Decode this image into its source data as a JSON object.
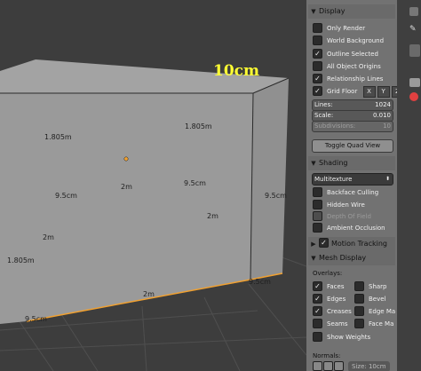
{
  "viewport": {
    "overlay_text": "10cm",
    "dimensions": [
      "1.805m",
      "1.805m",
      "2m",
      "9.5cm",
      "9.5cm",
      "9.5cm",
      "2m",
      "2m",
      "1.805m",
      "2m",
      "9.5cm",
      "9.5cm"
    ]
  },
  "panel": {
    "display": {
      "title": "Display",
      "only_render": "Only Render",
      "world_background": "World Background",
      "outline_selected": "Outline Selected",
      "all_object_origins": "All Object Origins",
      "relationship_lines": "Relationship Lines",
      "grid_floor": "Grid Floor",
      "axes": [
        "X",
        "Y",
        "Z"
      ],
      "lines_label": "Lines:",
      "lines_value": "1024",
      "scale_label": "Scale:",
      "scale_value": "0.010",
      "subdivisions_label": "Subdivisions:",
      "subdivisions_value": "10",
      "toggle_quad_view": "Toggle Quad View"
    },
    "shading": {
      "title": "Shading",
      "mode": "Multitexture",
      "backface_culling": "Backface Culling",
      "hidden_wire": "Hidden Wire",
      "depth_of_field": "Depth Of Field",
      "ambient_occlusion": "Ambient Occlusion"
    },
    "motion_tracking": {
      "title": "Motion Tracking"
    },
    "mesh_display": {
      "title": "Mesh Display",
      "overlays_label": "Overlays:",
      "faces": "Faces",
      "sharp": "Sharp",
      "edges": "Edges",
      "bevel": "Bevel",
      "creases": "Creases",
      "edge_ma": "Edge Ma",
      "seams": "Seams",
      "face_ma": "Face Ma",
      "show_weights": "Show Weights",
      "normals_label": "Normals:",
      "size_label": "Size: 10cm"
    }
  }
}
